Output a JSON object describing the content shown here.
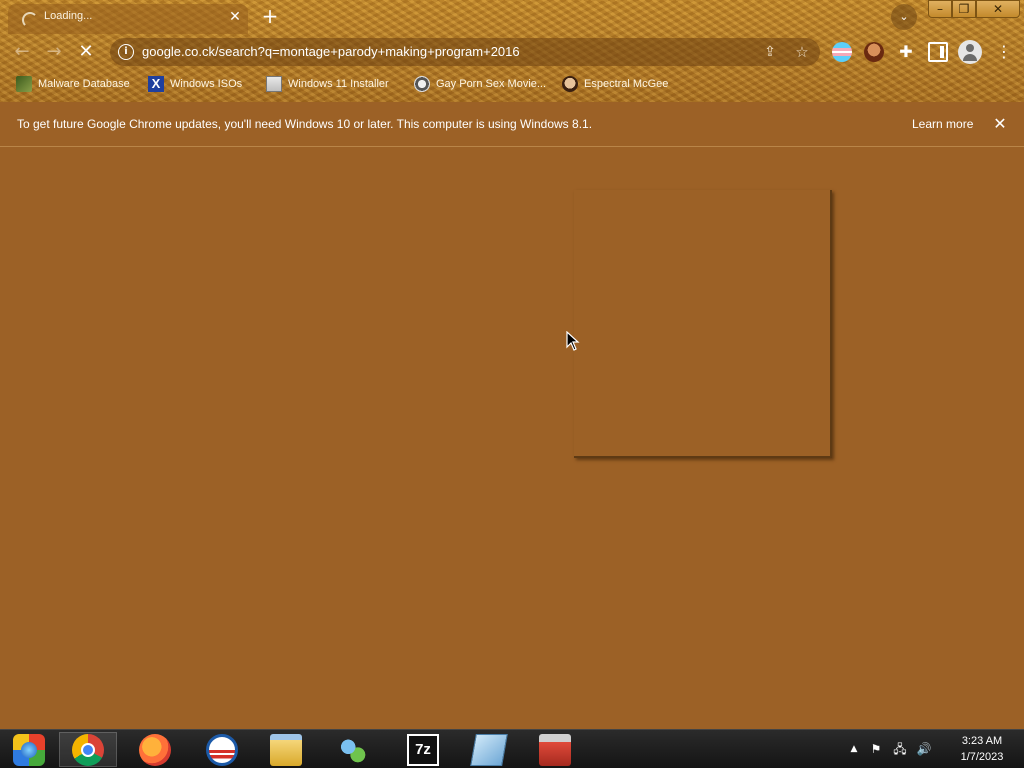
{
  "tab": {
    "title": "Loading..."
  },
  "toolbar": {
    "url": "google.co.ck/search?q=montage+parody+making+program+2016"
  },
  "bookmarks": [
    {
      "label": "Malware Database",
      "icon": "malware-database-icon"
    },
    {
      "label": "Windows ISOs",
      "icon": "windows-isos-icon"
    },
    {
      "label": "Windows 11 Installer",
      "icon": "windows-11-installer-icon"
    },
    {
      "label": "Gay Porn Sex Movie...",
      "icon": "movie-reel-icon"
    },
    {
      "label": "Espectral McGee",
      "icon": "espectral-mcgee-icon"
    }
  ],
  "infobar": {
    "message": "To get future Google Chrome updates, you'll need Windows 10 or later. This computer is using Windows 8.1.",
    "action_label": "Learn more"
  },
  "taskbar": {
    "apps": [
      "start",
      "chrome",
      "firefox",
      "obama",
      "file-explorer",
      "network",
      "7-zip",
      "notes",
      "toolbox"
    ],
    "clock": {
      "time": "3:23 AM",
      "date": "1/7/2023"
    }
  },
  "colors": {
    "content_bg": "#9c6126",
    "frame": "#b9812a"
  }
}
